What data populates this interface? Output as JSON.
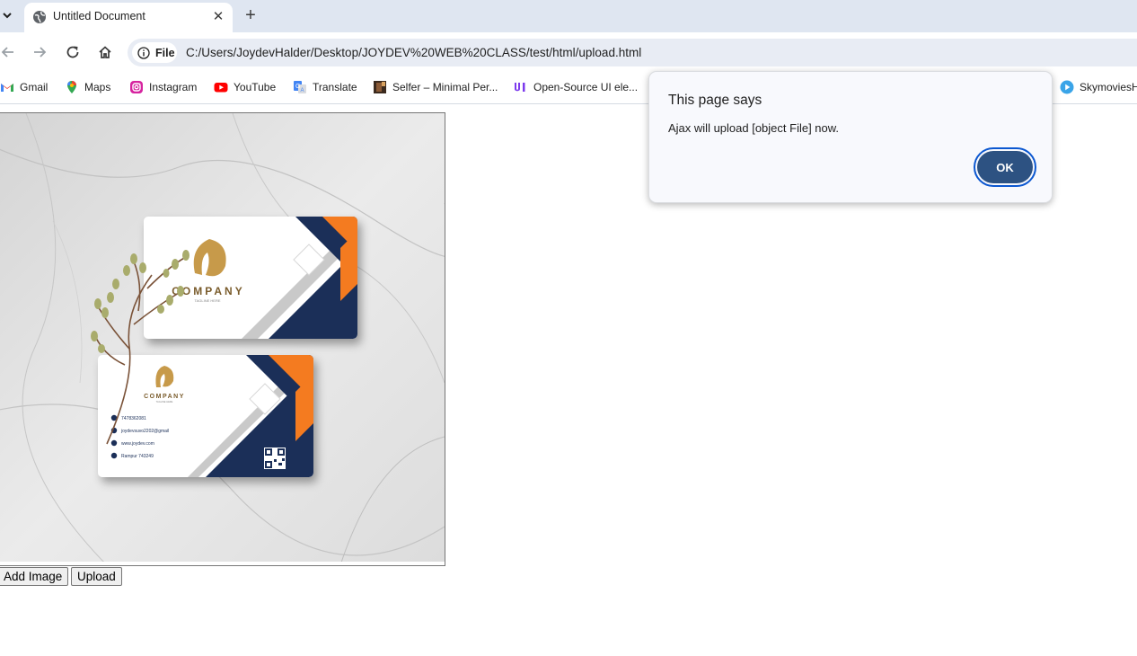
{
  "browser": {
    "tab": {
      "title": "Untitled Document",
      "close_glyph": "✕"
    },
    "new_tab_glyph": "+",
    "address": {
      "chip_label": "File",
      "url": "C:/Users/JoydevHalder/Desktop/JOYDEV%20WEB%20CLASS/test/html/upload.html"
    },
    "bookmarks": [
      {
        "label": "Gmail",
        "icon": "gmail-icon"
      },
      {
        "label": "Maps",
        "icon": "maps-icon"
      },
      {
        "label": "Instagram",
        "icon": "instagram-icon"
      },
      {
        "label": "YouTube",
        "icon": "youtube-icon"
      },
      {
        "label": "Translate",
        "icon": "translate-icon"
      },
      {
        "label": "Selfer – Minimal Per...",
        "icon": "selfer-icon"
      },
      {
        "label": "Open-Source UI ele...",
        "icon": "ui-icon"
      },
      {
        "label": "SkymoviesH",
        "icon": "play-icon"
      }
    ]
  },
  "page": {
    "add_image_label": "Add Image",
    "upload_label": "Upload",
    "preview": {
      "card_front": {
        "company": "COMPANY",
        "tagline": "TAGLINE HERE"
      },
      "card_back": {
        "company": "COMPANY",
        "tagline": "TAGLINE HERE",
        "contacts": [
          "7478362081",
          "joydevsuvo2202@gmail",
          "www.joydev.com",
          "Rampur 743249"
        ]
      }
    }
  },
  "dialog": {
    "title": "This page says",
    "message": "Ajax will upload [object File] now.",
    "ok_label": "OK"
  },
  "colors": {
    "tabstrip": "#dfe6f1",
    "dialog_ok": "#2d5282",
    "card_navy": "#1b2f58",
    "card_orange": "#f47b20",
    "gold": "#c79a4a"
  }
}
